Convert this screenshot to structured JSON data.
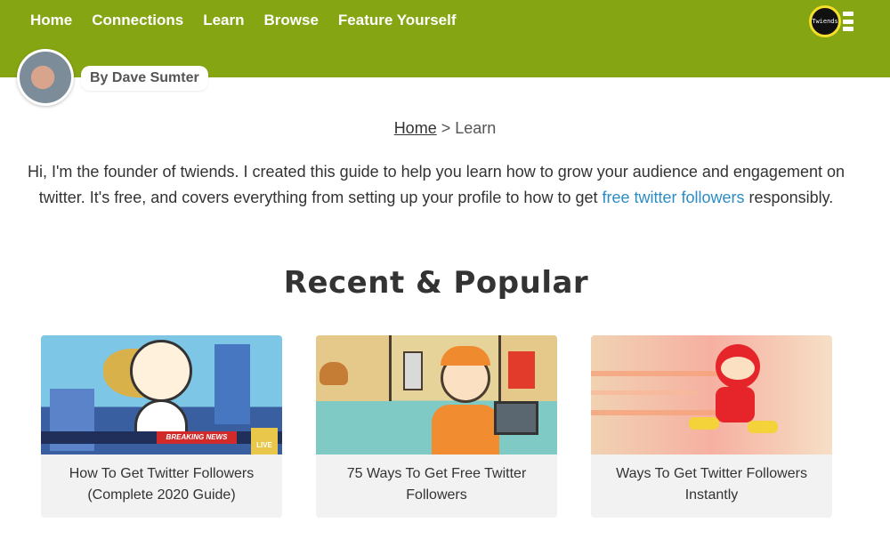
{
  "nav": {
    "items": [
      "Home",
      "Connections",
      "Learn",
      "Browse",
      "Feature Yourself"
    ],
    "logo_text": "Twiends"
  },
  "author": {
    "label": "By Dave Sumter"
  },
  "breadcrumb": {
    "home": "Home",
    "separator": ">",
    "current": "Learn"
  },
  "intro": {
    "text_before": "Hi, I'm the founder of twiends. I created this guide to help you learn how to grow your audience and engagement on twitter. It's free, and covers everything from setting up your profile to how to get ",
    "link_text": "free twitter followers",
    "text_after": " responsibly."
  },
  "section": {
    "title": "Recent & Popular"
  },
  "cards": [
    {
      "title": "How To Get Twitter Followers (Complete 2020 Guide)",
      "badge": "BREAKING NEWS",
      "live": "LIVE"
    },
    {
      "title": "75 Ways To Get Free Twitter Followers"
    },
    {
      "title": "Ways To Get Twitter Followers Instantly"
    }
  ],
  "colors": {
    "header": "#86a513",
    "link": "#2b8dc4",
    "card_bg": "#f2f2f2"
  }
}
